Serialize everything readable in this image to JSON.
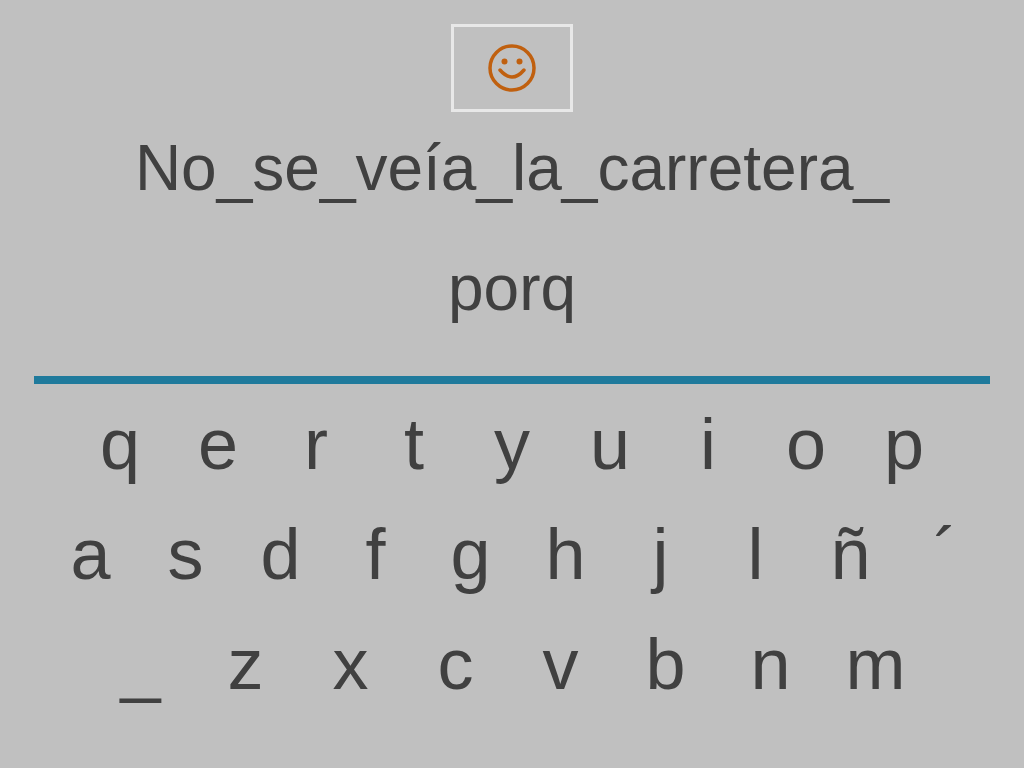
{
  "sentence_lines": [
    "No_se_veía_la_carretera_",
    "porq"
  ],
  "keyboard_rows": [
    [
      "q",
      "e",
      "r",
      "t",
      "y",
      "u",
      "i",
      "o",
      "p"
    ],
    [
      "a",
      "s",
      "d",
      "f",
      "g",
      "h",
      "j",
      "l",
      "ñ",
      "´"
    ],
    [
      "_",
      "z",
      "x",
      "c",
      "v",
      "b",
      "n",
      "m"
    ]
  ]
}
